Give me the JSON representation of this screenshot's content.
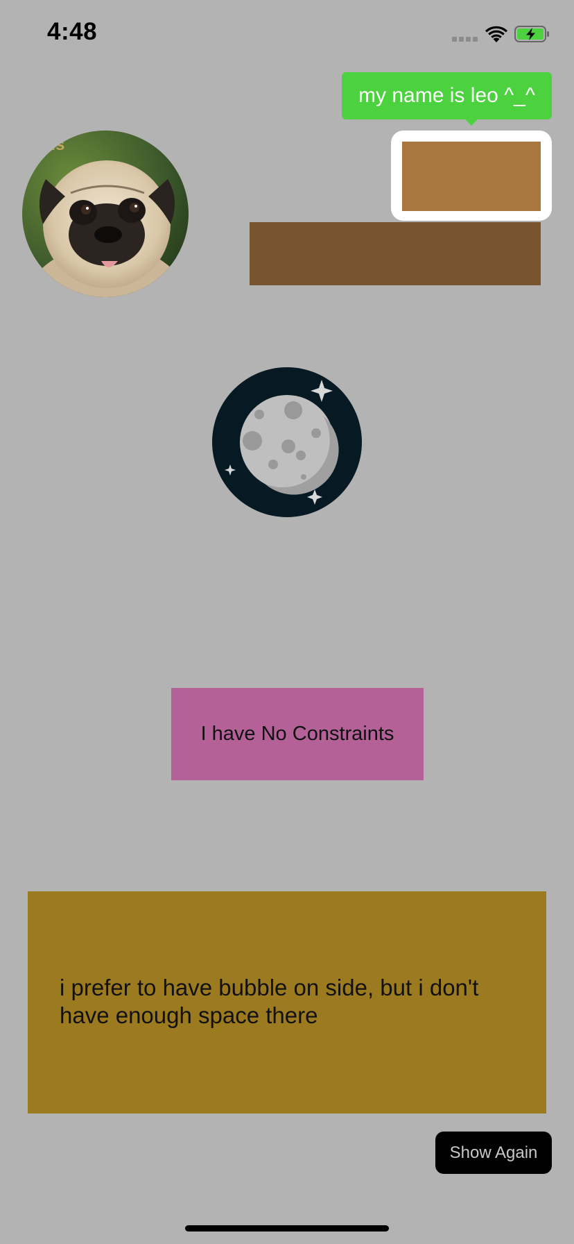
{
  "status_bar": {
    "time": "4:48",
    "signal_icon": "cellular-signal-icon",
    "wifi_icon": "wifi-icon",
    "battery_icon": "battery-charging-icon"
  },
  "tooltip": {
    "text": "my name is leo ^_^",
    "color": "#4cd23f"
  },
  "avatar": {
    "icon": "pug-avatar-image"
  },
  "moon": {
    "icon": "moon-image"
  },
  "pink_box": {
    "label": "I have No Constraints",
    "color": "#b36197"
  },
  "gold_box": {
    "text": "i prefer to have bubble on side, but i don't have enough space there",
    "color": "#9c7b20"
  },
  "show_again_button": {
    "label": "Show Again"
  },
  "colors": {
    "overlay_background": "#b3b3b3",
    "highlight_target": "#a9773f",
    "brown_bar": "#78552f"
  }
}
